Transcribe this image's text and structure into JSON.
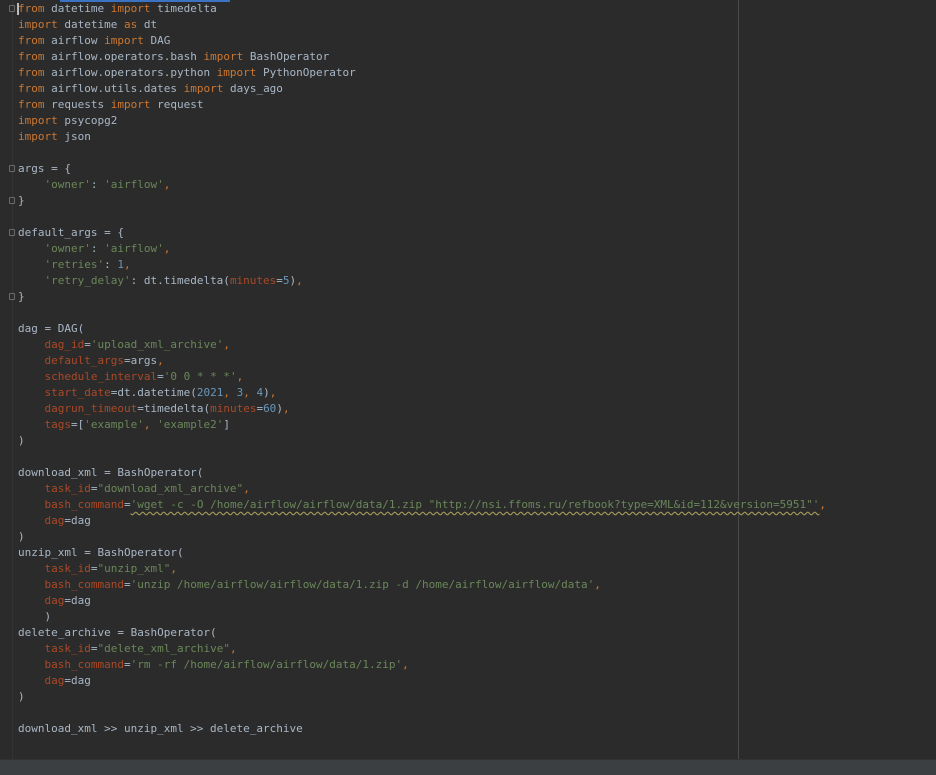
{
  "colors": {
    "background": "#2b2b2b",
    "keyword": "#cc7832",
    "string": "#6a8759",
    "number": "#6897bb",
    "parameter": "#aa4926",
    "default_text": "#a9b7c6"
  },
  "lines": [
    [
      {
        "t": "kw",
        "v": "from"
      },
      {
        "t": "plain",
        "v": " datetime "
      },
      {
        "t": "kw",
        "v": "import"
      },
      {
        "t": "plain",
        "v": " timedelta"
      }
    ],
    [
      {
        "t": "kw",
        "v": "import"
      },
      {
        "t": "plain",
        "v": " datetime "
      },
      {
        "t": "kw",
        "v": "as"
      },
      {
        "t": "plain",
        "v": " dt"
      }
    ],
    [
      {
        "t": "kw",
        "v": "from"
      },
      {
        "t": "plain",
        "v": " airflow "
      },
      {
        "t": "kw",
        "v": "import"
      },
      {
        "t": "plain",
        "v": " DAG"
      }
    ],
    [
      {
        "t": "kw",
        "v": "from"
      },
      {
        "t": "plain",
        "v": " airflow.operators.bash "
      },
      {
        "t": "kw",
        "v": "import"
      },
      {
        "t": "plain",
        "v": " BashOperator"
      }
    ],
    [
      {
        "t": "kw",
        "v": "from"
      },
      {
        "t": "plain",
        "v": " airflow.operators.python "
      },
      {
        "t": "kw",
        "v": "import"
      },
      {
        "t": "plain",
        "v": " PythonOperator"
      }
    ],
    [
      {
        "t": "kw",
        "v": "from"
      },
      {
        "t": "plain",
        "v": " airflow.utils.dates "
      },
      {
        "t": "kw",
        "v": "import"
      },
      {
        "t": "plain",
        "v": " days_ago"
      }
    ],
    [
      {
        "t": "kw",
        "v": "from"
      },
      {
        "t": "plain",
        "v": " requests "
      },
      {
        "t": "kw",
        "v": "import"
      },
      {
        "t": "plain",
        "v": " request"
      }
    ],
    [
      {
        "t": "kw",
        "v": "import"
      },
      {
        "t": "plain",
        "v": " psycopg2"
      }
    ],
    [
      {
        "t": "kw",
        "v": "import"
      },
      {
        "t": "plain",
        "v": " json"
      }
    ],
    [],
    [
      {
        "t": "plain",
        "v": "args = {"
      }
    ],
    [
      {
        "t": "plain",
        "v": "    "
      },
      {
        "t": "str",
        "v": "'owner'"
      },
      {
        "t": "plain",
        "v": ": "
      },
      {
        "t": "str",
        "v": "'airflow'"
      },
      {
        "t": "kw",
        "v": ","
      }
    ],
    [
      {
        "t": "plain",
        "v": "}"
      }
    ],
    [],
    [
      {
        "t": "plain",
        "v": "default_args = {"
      }
    ],
    [
      {
        "t": "plain",
        "v": "    "
      },
      {
        "t": "str",
        "v": "'owner'"
      },
      {
        "t": "plain",
        "v": ": "
      },
      {
        "t": "str",
        "v": "'airflow'"
      },
      {
        "t": "kw",
        "v": ","
      }
    ],
    [
      {
        "t": "plain",
        "v": "    "
      },
      {
        "t": "str",
        "v": "'retries'"
      },
      {
        "t": "plain",
        "v": ": "
      },
      {
        "t": "num",
        "v": "1"
      },
      {
        "t": "kw",
        "v": ","
      }
    ],
    [
      {
        "t": "plain",
        "v": "    "
      },
      {
        "t": "str",
        "v": "'retry_delay'"
      },
      {
        "t": "plain",
        "v": ": dt.timedelta("
      },
      {
        "t": "param",
        "v": "minutes"
      },
      {
        "t": "plain",
        "v": "="
      },
      {
        "t": "num",
        "v": "5"
      },
      {
        "t": "plain",
        "v": ")"
      },
      {
        "t": "kw",
        "v": ","
      }
    ],
    [
      {
        "t": "plain",
        "v": "}"
      }
    ],
    [],
    [
      {
        "t": "plain",
        "v": "dag = DAG("
      }
    ],
    [
      {
        "t": "plain",
        "v": "    "
      },
      {
        "t": "param",
        "v": "dag_id"
      },
      {
        "t": "plain",
        "v": "="
      },
      {
        "t": "str",
        "v": "'upload_xml_archive'"
      },
      {
        "t": "kw",
        "v": ","
      }
    ],
    [
      {
        "t": "plain",
        "v": "    "
      },
      {
        "t": "param",
        "v": "default_args"
      },
      {
        "t": "plain",
        "v": "=args"
      },
      {
        "t": "kw",
        "v": ","
      }
    ],
    [
      {
        "t": "plain",
        "v": "    "
      },
      {
        "t": "param",
        "v": "schedule_interval"
      },
      {
        "t": "plain",
        "v": "="
      },
      {
        "t": "str",
        "v": "'0 0 * * *'"
      },
      {
        "t": "kw",
        "v": ","
      }
    ],
    [
      {
        "t": "plain",
        "v": "    "
      },
      {
        "t": "param",
        "v": "start_date"
      },
      {
        "t": "plain",
        "v": "=dt.datetime("
      },
      {
        "t": "num",
        "v": "2021"
      },
      {
        "t": "kw",
        "v": ", "
      },
      {
        "t": "num",
        "v": "3"
      },
      {
        "t": "kw",
        "v": ", "
      },
      {
        "t": "num",
        "v": "4"
      },
      {
        "t": "plain",
        "v": ")"
      },
      {
        "t": "kw",
        "v": ","
      }
    ],
    [
      {
        "t": "plain",
        "v": "    "
      },
      {
        "t": "param",
        "v": "dagrun_timeout"
      },
      {
        "t": "plain",
        "v": "=timedelta("
      },
      {
        "t": "param",
        "v": "minutes"
      },
      {
        "t": "plain",
        "v": "="
      },
      {
        "t": "num",
        "v": "60"
      },
      {
        "t": "plain",
        "v": ")"
      },
      {
        "t": "kw",
        "v": ","
      }
    ],
    [
      {
        "t": "plain",
        "v": "    "
      },
      {
        "t": "param",
        "v": "tags"
      },
      {
        "t": "plain",
        "v": "=["
      },
      {
        "t": "str",
        "v": "'example'"
      },
      {
        "t": "kw",
        "v": ", "
      },
      {
        "t": "str",
        "v": "'example2'"
      },
      {
        "t": "plain",
        "v": "]"
      }
    ],
    [
      {
        "t": "plain",
        "v": ")"
      }
    ],
    [],
    [
      {
        "t": "plain",
        "v": "download_xml = BashOperator("
      }
    ],
    [
      {
        "t": "plain",
        "v": "    "
      },
      {
        "t": "param",
        "v": "task_id"
      },
      {
        "t": "plain",
        "v": "="
      },
      {
        "t": "str",
        "v": "\"download_xml_archive\""
      },
      {
        "t": "kw",
        "v": ","
      }
    ],
    [
      {
        "t": "plain",
        "v": "    "
      },
      {
        "t": "param",
        "v": "bash_command"
      },
      {
        "t": "plain",
        "v": "="
      },
      {
        "t": "str squiggle",
        "v": "'wget -c -O /home/airflow/airflow/data/1.zip \"http://nsi.ffoms.ru/refbook?type=XML&id=112&version=5951\"'"
      },
      {
        "t": "kw",
        "v": ","
      }
    ],
    [
      {
        "t": "plain",
        "v": "    "
      },
      {
        "t": "param",
        "v": "dag"
      },
      {
        "t": "plain",
        "v": "=dag"
      }
    ],
    [
      {
        "t": "plain",
        "v": ")"
      }
    ],
    [
      {
        "t": "plain",
        "v": "unzip_xml = BashOperator("
      }
    ],
    [
      {
        "t": "plain",
        "v": "    "
      },
      {
        "t": "param",
        "v": "task_id"
      },
      {
        "t": "plain",
        "v": "="
      },
      {
        "t": "str",
        "v": "\"unzip_xml\""
      },
      {
        "t": "kw",
        "v": ","
      }
    ],
    [
      {
        "t": "plain",
        "v": "    "
      },
      {
        "t": "param",
        "v": "bash_command"
      },
      {
        "t": "plain",
        "v": "="
      },
      {
        "t": "str",
        "v": "'unzip /home/airflow/airflow/data/1.zip -d /home/airflow/airflow/data'"
      },
      {
        "t": "kw",
        "v": ","
      }
    ],
    [
      {
        "t": "plain",
        "v": "    "
      },
      {
        "t": "param",
        "v": "dag"
      },
      {
        "t": "plain",
        "v": "=dag"
      }
    ],
    [
      {
        "t": "plain",
        "v": "    )"
      }
    ],
    [
      {
        "t": "plain",
        "v": "delete_archive = BashOperator("
      }
    ],
    [
      {
        "t": "plain",
        "v": "    "
      },
      {
        "t": "param",
        "v": "task_id"
      },
      {
        "t": "plain",
        "v": "="
      },
      {
        "t": "str",
        "v": "\"delete_xml_archive\""
      },
      {
        "t": "kw",
        "v": ","
      }
    ],
    [
      {
        "t": "plain",
        "v": "    "
      },
      {
        "t": "param",
        "v": "bash_command"
      },
      {
        "t": "plain",
        "v": "="
      },
      {
        "t": "str",
        "v": "'rm -rf /home/airflow/airflow/data/1.zip'"
      },
      {
        "t": "kw",
        "v": ","
      }
    ],
    [
      {
        "t": "plain",
        "v": "    "
      },
      {
        "t": "param",
        "v": "dag"
      },
      {
        "t": "plain",
        "v": "=dag"
      }
    ],
    [
      {
        "t": "plain",
        "v": ")"
      }
    ],
    [],
    [
      {
        "t": "plain",
        "v": "download_xml >> unzip_xml >> delete_archive"
      }
    ]
  ],
  "fold_markers": [
    0,
    10,
    12,
    14,
    18
  ]
}
